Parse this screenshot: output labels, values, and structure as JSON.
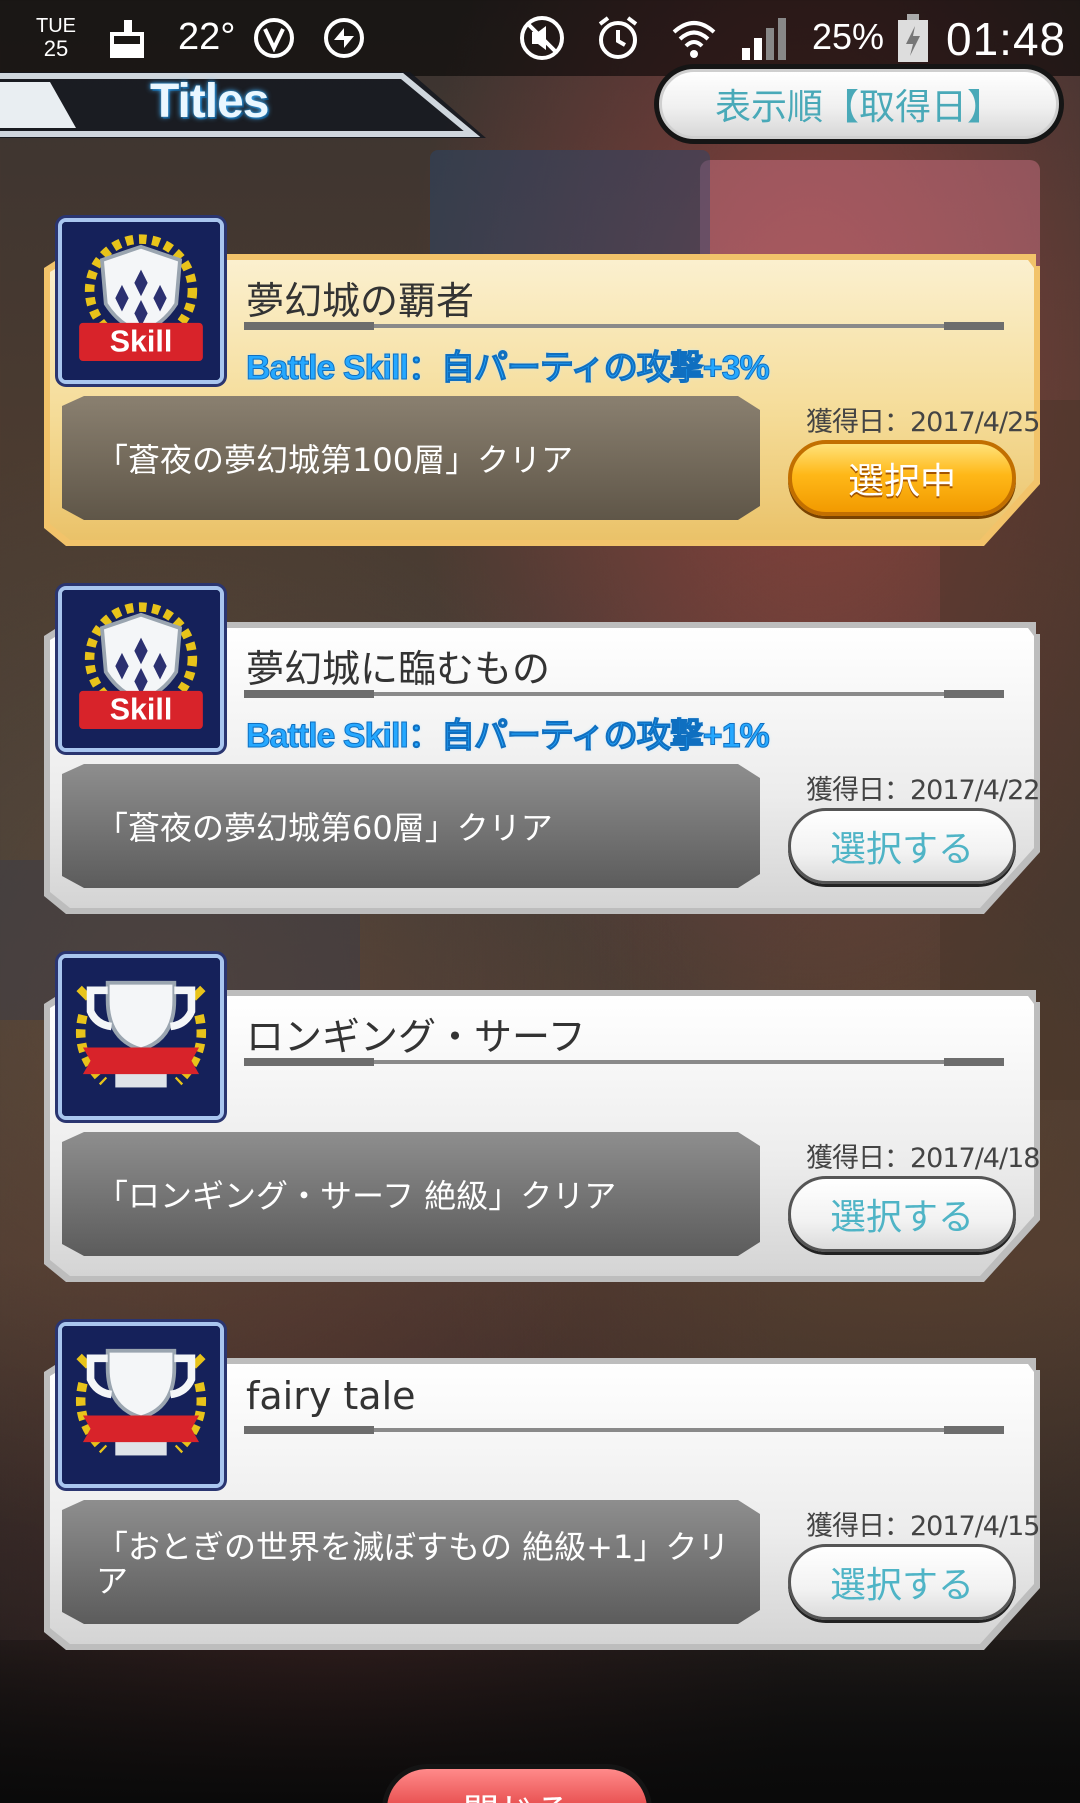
{
  "status_bar": {
    "day": "TUE",
    "date": "25",
    "temperature": "22°",
    "battery_percent": "25%",
    "time": "01:48",
    "icons": [
      "cleaner-icon",
      "vpn-icon",
      "sync-icon",
      "mute-icon",
      "alarm-icon",
      "wifi-icon",
      "signal-icon",
      "battery-icon"
    ]
  },
  "header": {
    "title": "Titles",
    "sort_label": "表示順【取得日】"
  },
  "titles": [
    {
      "name": "夢幻城の覇者",
      "badge": "skill",
      "badge_label": "Skill",
      "skill": "Battle Skill：自パーティの攻撃+3%",
      "condition": "「蒼夜の夢幻城第100層」クリア",
      "acquired": "獲得日：2017/4/25",
      "button": "選択中",
      "selected": true
    },
    {
      "name": "夢幻城に臨むもの",
      "badge": "skill",
      "badge_label": "Skill",
      "skill": "Battle Skill：自パーティの攻撃+1%",
      "condition": "「蒼夜の夢幻城第60層」クリア",
      "acquired": "獲得日：2017/4/22",
      "button": "選択する",
      "selected": false
    },
    {
      "name": "ロンギング・サーフ",
      "badge": "trophy",
      "skill": "",
      "condition": "「ロンギング・サーフ 絶級」クリア",
      "acquired": "獲得日：2017/4/18",
      "button": "選択する",
      "selected": false
    },
    {
      "name": "fairy tale",
      "badge": "trophy",
      "skill": "",
      "condition": "「おとぎの世界を滅ぼすもの 絶級+1」クリア",
      "acquired": "獲得日：2017/4/15",
      "button": "選択する",
      "selected": false
    }
  ],
  "footer": {
    "close_label": "閉じる"
  },
  "colors": {
    "skill_blue": "#25a8ff",
    "selected_orange": "#ffb818",
    "select_teal": "#4fb4c6",
    "selected_card": "#f7e1a4"
  }
}
